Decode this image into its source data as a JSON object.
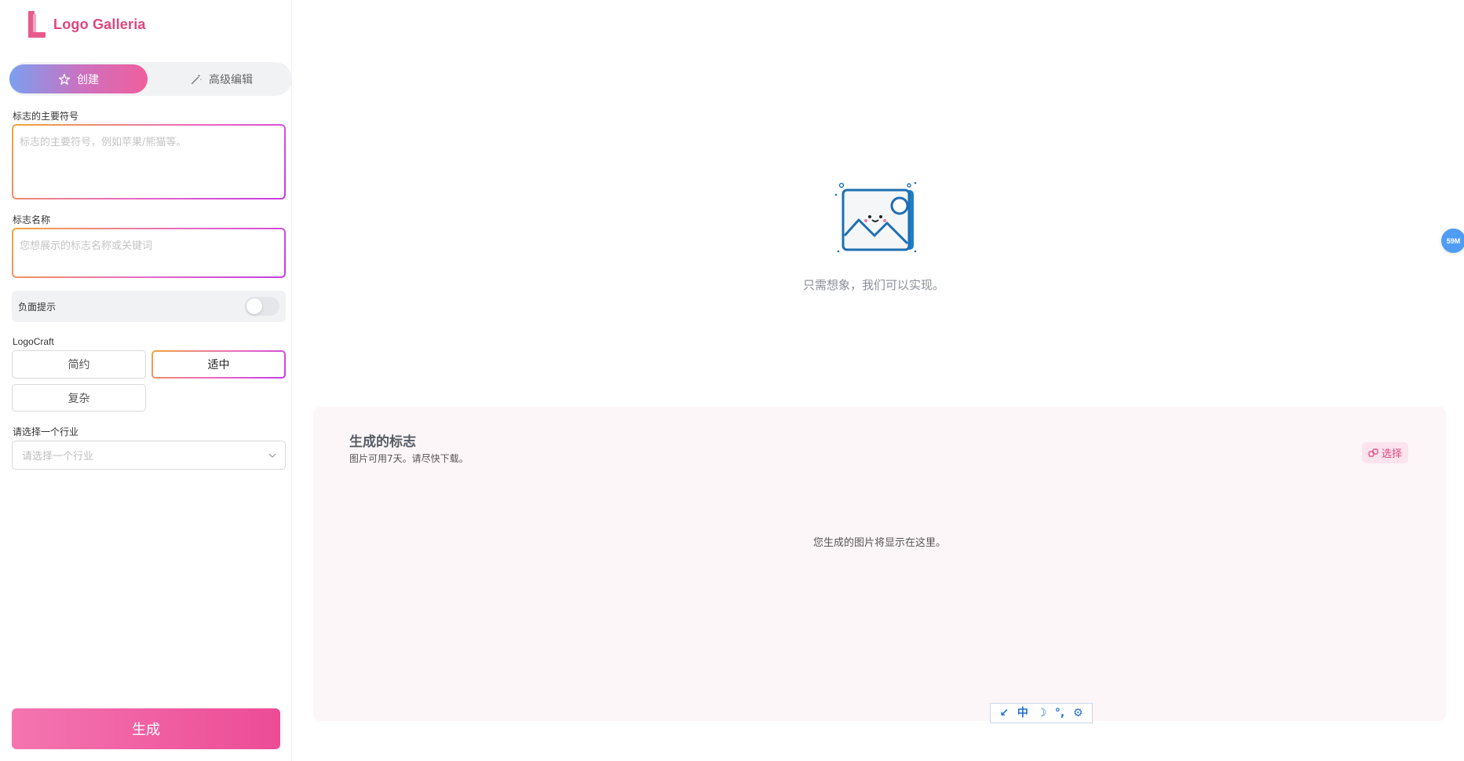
{
  "brand": {
    "name": "Logo Galleria"
  },
  "mode_tabs": {
    "create": "创建",
    "advanced": "高级编辑"
  },
  "form": {
    "symbol_label": "标志的主要符号",
    "symbol_placeholder": "标志的主要符号，例如苹果/熊猫等。",
    "name_label": "标志名称",
    "name_placeholder": "您想展示的标志名称或关键词",
    "negative_prompt_label": "负面提示",
    "negative_prompt_enabled": false,
    "craft_label": "LogoCraft",
    "craft_options": [
      "简约",
      "适中",
      "复杂"
    ],
    "craft_selected": "适中",
    "industry_label": "请选择一个行业",
    "industry_placeholder": "请选择一个行业",
    "generate_label": "生成"
  },
  "hero": {
    "text": "只需想象，我们可以实现。"
  },
  "results": {
    "title": "生成的标志",
    "subtitle": "图片可用7天。请尽快下载。",
    "select_label": "选择",
    "empty_text": "您生成的图片将显示在这里。"
  },
  "float_badge": {
    "text": "59M"
  },
  "toolbar": {
    "items": [
      "↙",
      "中",
      "☽",
      "°,",
      "⚙"
    ]
  },
  "colors": {
    "accent": "#e95a8c",
    "brand_text": "#e0457e",
    "badge": "#4e9cf4"
  }
}
